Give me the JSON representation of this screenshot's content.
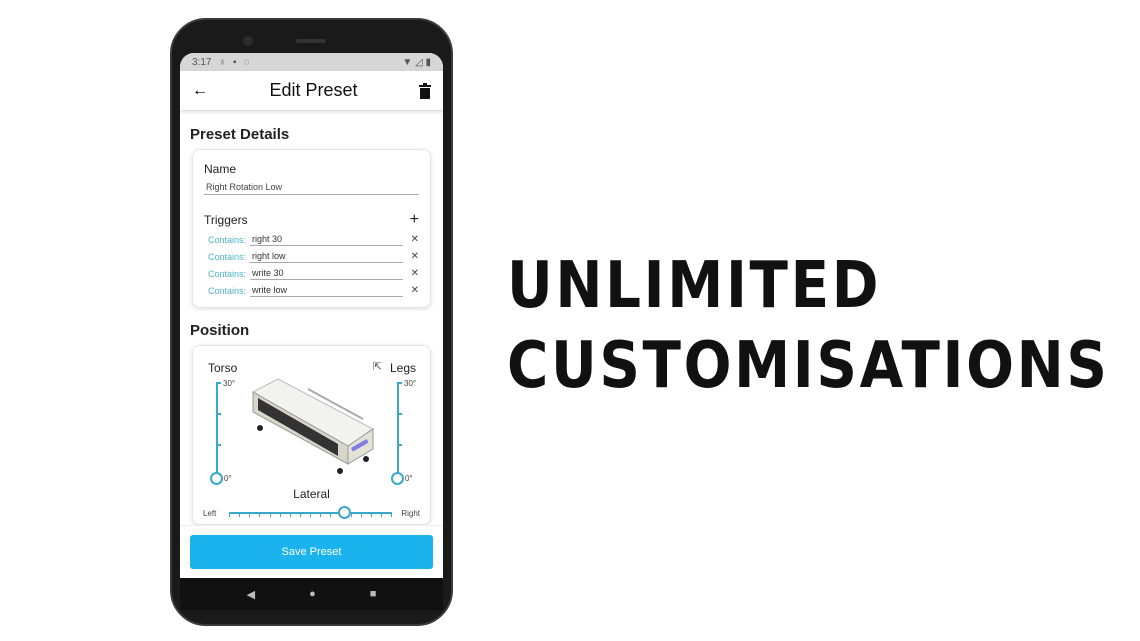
{
  "status_bar": {
    "time": "3:17"
  },
  "app_bar": {
    "title": "Edit Preset"
  },
  "preset_details": {
    "heading": "Preset Details",
    "name_label": "Name",
    "name_value": "Right Rotation Low",
    "triggers_label": "Triggers",
    "triggers": [
      {
        "type": "Contains:",
        "value": "right 30"
      },
      {
        "type": "Contains:",
        "value": "right low"
      },
      {
        "type": "Contains:",
        "value": "write 30"
      },
      {
        "type": "Contains:",
        "value": "write low"
      }
    ]
  },
  "position": {
    "heading": "Position",
    "torso": {
      "label": "Torso",
      "max": "30°",
      "min": "0°",
      "value": 0
    },
    "legs": {
      "label": "Legs",
      "max": "30°",
      "min": "0°",
      "value": 0
    },
    "lateral": {
      "label": "Lateral",
      "left": "Left",
      "right": "Right",
      "value_fraction": 0.71
    }
  },
  "save_label": "Save Preset",
  "headline": {
    "line1": "UNLIMITED",
    "line2": "CUSTOMISATIONS"
  },
  "colors": {
    "accent": "#3aa8c8",
    "button": "#1bb3ee",
    "trigger_label": "#4fb3cd"
  }
}
